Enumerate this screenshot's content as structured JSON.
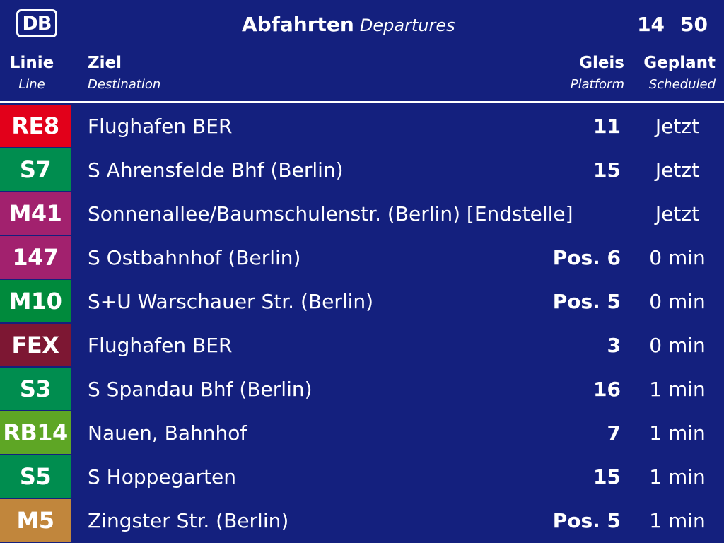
{
  "header": {
    "logo": "DB",
    "title_de": "Abfahrten",
    "title_en": "Departures",
    "clock_hours": "14",
    "clock_minutes": "50"
  },
  "columns": {
    "line_de": "Linie",
    "line_en": "Line",
    "dest_de": "Ziel",
    "dest_en": "Destination",
    "platform_de": "Gleis",
    "platform_en": "Platform",
    "scheduled_de": "Geplant",
    "scheduled_en": "Scheduled"
  },
  "departures": [
    {
      "line": "RE8",
      "color": "#e2001a",
      "destination": "Flughafen BER",
      "platform": "11",
      "time": "Jetzt"
    },
    {
      "line": "S7",
      "color": "#008d4f",
      "destination": "S Ahrensfelde Bhf (Berlin)",
      "platform": "15",
      "time": "Jetzt"
    },
    {
      "line": "M41",
      "color": "#a2216e",
      "destination": "Sonnenallee/Baumschulenstr. (Berlin) [Endstelle]",
      "platform": "",
      "time": "Jetzt"
    },
    {
      "line": "147",
      "color": "#a2216e",
      "destination": "S Ostbahnhof (Berlin)",
      "platform": "Pos. 6",
      "time": "0 min"
    },
    {
      "line": "M10",
      "color": "#008a3c",
      "destination": "S+U Warschauer Str. (Berlin)",
      "platform": "Pos. 5",
      "time": "0 min"
    },
    {
      "line": "FEX",
      "color": "#7d1733",
      "destination": "Flughafen BER",
      "platform": "3",
      "time": "0 min"
    },
    {
      "line": "S3",
      "color": "#008d4f",
      "destination": "S Spandau Bhf (Berlin)",
      "platform": "16",
      "time": "1 min"
    },
    {
      "line": "RB14",
      "color": "#5ea625",
      "destination": "Nauen, Bahnhof",
      "platform": "7",
      "time": "1 min"
    },
    {
      "line": "S5",
      "color": "#008d4f",
      "destination": "S Hoppegarten",
      "platform": "15",
      "time": "1 min"
    },
    {
      "line": "M5",
      "color": "#c1863c",
      "destination": "Zingster Str. (Berlin)",
      "platform": "Pos. 5",
      "time": "1 min"
    }
  ]
}
